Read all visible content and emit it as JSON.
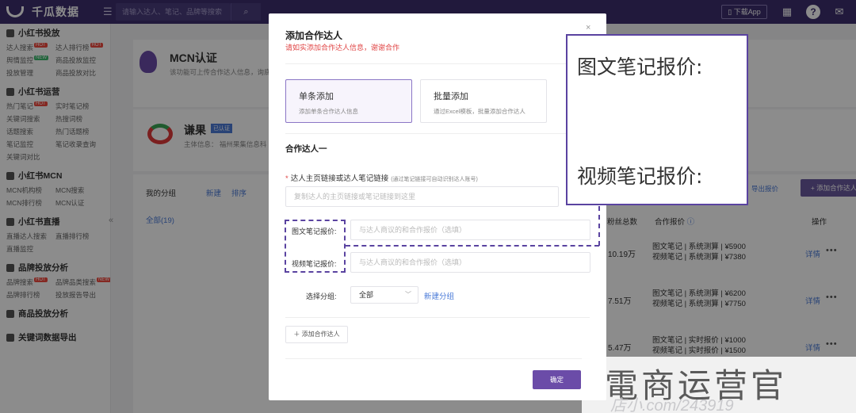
{
  "topbar": {
    "app_name": "千瓜数据",
    "search_placeholder": "请输入达人、笔记、品牌等搜索",
    "download_app": "下载App"
  },
  "sidebar": {
    "sections": [
      {
        "title": "小红书投放",
        "items": [
          {
            "label": "达人搜索",
            "badge": "HOT",
            "badge_color": "red"
          },
          {
            "label": "达人排行榜",
            "badge": "HOT",
            "badge_color": "red"
          },
          {
            "label": "舆情监控",
            "badge": "NEW",
            "badge_color": "green"
          },
          {
            "label": "商品投放监控",
            "badge": "",
            "badge_color": ""
          },
          {
            "label": "投放管理",
            "badge": "",
            "badge_color": ""
          },
          {
            "label": "商品投放对比",
            "badge": "",
            "badge_color": ""
          }
        ]
      },
      {
        "title": "小红书运营",
        "items": [
          {
            "label": "热门笔记",
            "badge": "HOT",
            "badge_color": "red"
          },
          {
            "label": "实时笔记榜",
            "badge": "",
            "badge_color": ""
          },
          {
            "label": "关键词搜索",
            "badge": "",
            "badge_color": ""
          },
          {
            "label": "热搜词榜",
            "badge": "",
            "badge_color": ""
          },
          {
            "label": "话题搜索",
            "badge": "",
            "badge_color": ""
          },
          {
            "label": "热门话题榜",
            "badge": "",
            "badge_color": ""
          },
          {
            "label": "笔记监控",
            "badge": "",
            "badge_color": ""
          },
          {
            "label": "笔记收录查询",
            "badge": "",
            "badge_color": ""
          },
          {
            "label": "关键词对比",
            "badge": "",
            "badge_color": ""
          }
        ]
      },
      {
        "title": "小红书MCN",
        "items": [
          {
            "label": "MCN机构榜",
            "badge": "",
            "badge_color": ""
          },
          {
            "label": "MCN搜索",
            "badge": "",
            "badge_color": ""
          },
          {
            "label": "MCN排行榜",
            "badge": "",
            "badge_color": ""
          },
          {
            "label": "MCN认证",
            "badge": "",
            "badge_color": ""
          }
        ]
      },
      {
        "title": "小红书直播",
        "items": [
          {
            "label": "直播达人搜索",
            "badge": "",
            "badge_color": ""
          },
          {
            "label": "直播排行榜",
            "badge": "",
            "badge_color": ""
          },
          {
            "label": "直播监控",
            "badge": "",
            "badge_color": ""
          }
        ]
      },
      {
        "title": "品牌投放分析",
        "items": [
          {
            "label": "品牌搜索",
            "badge": "HOT",
            "badge_color": "red"
          },
          {
            "label": "品牌品类搜索",
            "badge": "NEW",
            "badge_color": "red"
          },
          {
            "label": "品牌排行榜",
            "badge": "",
            "badge_color": ""
          },
          {
            "label": "投放报告导出",
            "badge": "",
            "badge_color": ""
          }
        ]
      },
      {
        "title": "商品投放分析",
        "items": []
      },
      {
        "title": "关键词数据导出",
        "items": []
      }
    ]
  },
  "background": {
    "mcn_title": "MCN认证",
    "mcn_desc": "该功能可上传合作达人信息，询底...",
    "brand_name": "谦果",
    "brand_badge": "已认证",
    "brand_info": "主体信息：  福州果集信息科",
    "my_groups": "我的分组",
    "new_label": "新建",
    "sort_label": "排序",
    "group_all": "全部(19)",
    "export_link": "导出报价",
    "add_partner": "+ 添加合作达人",
    "col_fans": "粉丝总数",
    "col_price": "合作报价",
    "col_op": "操作",
    "rows": [
      {
        "fans": "10.19万",
        "price_line1": "图文笔记 | 系统测算 | ¥5900",
        "price_line2": "视频笔记 | 系统测算 | ¥7380",
        "detail": "详情"
      },
      {
        "fans": "7.51万",
        "price_line1": "图文笔记 | 系统测算 | ¥6200",
        "price_line2": "视频笔记 | 系统测算 | ¥7750",
        "detail": "详情"
      },
      {
        "fans": "5.47万",
        "price_line1": "图文笔记 | 实时报价 | ¥1000",
        "price_line2": "视频笔记 | 实时报价 | ¥1500",
        "detail": "详情"
      }
    ]
  },
  "modal": {
    "title": "添加合作达人",
    "subtitle": "请如实添加合作达人信息，谢谢合作",
    "modes": [
      {
        "title": "单条添加",
        "desc": "添加单条合作达人信息"
      },
      {
        "title": "批量添加",
        "desc": "通过Excel模板，批量添加合作达人"
      }
    ],
    "section_title": "合作达人一",
    "link_label": "达人主页链接或达人笔记链接",
    "link_hint": "(通过笔记链接可自动识别达人账号)",
    "link_placeholder": "复制达人的主页链接或笔记链接到这里",
    "image_note_label": "图文笔记报价:",
    "image_note_placeholder": "与达人商议的和合作报价（选填）",
    "video_note_label": "视频笔记报价:",
    "video_note_placeholder": "与达人商议的和合作报价（选填）",
    "group_label": "选择分组:",
    "group_value": "全部",
    "new_group": "新建分组",
    "add_partner": "添加合作达人",
    "confirm": "确定"
  },
  "callout": {
    "line1": "图文笔记报价:",
    "line2": "视频笔记报价:"
  },
  "watermark": {
    "text": "電商运营官",
    "sub": "店小.com/243919"
  }
}
